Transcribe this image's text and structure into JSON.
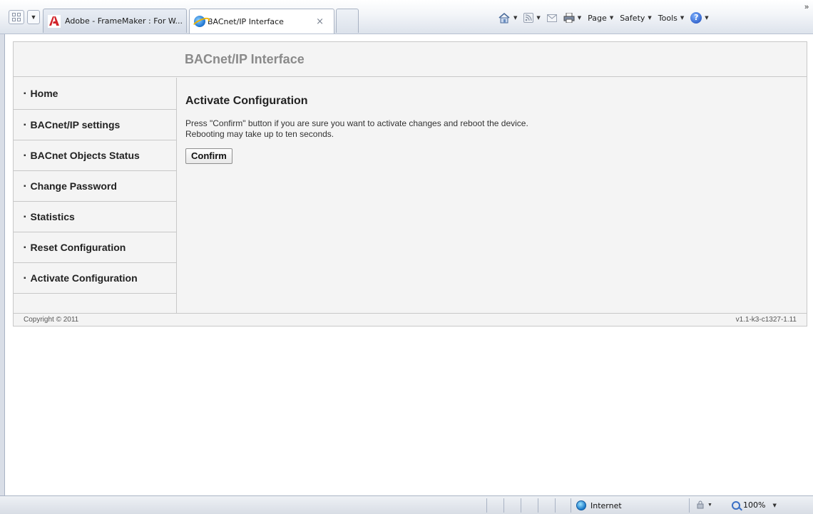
{
  "browser": {
    "tabs": [
      {
        "title": "Adobe - FrameMaker : For W..."
      },
      {
        "title": "BACnet/IP Interface",
        "close": "×"
      }
    ],
    "commands": {
      "page": "Page",
      "safety": "Safety",
      "tools": "Tools",
      "help": "?"
    },
    "status": {
      "zone": "Internet",
      "zoom": "100%"
    }
  },
  "page": {
    "banner_title": "BACnet/IP Interface",
    "nav": [
      {
        "label": "Home"
      },
      {
        "label": "BACnet/IP settings"
      },
      {
        "label": "BACnet Objects Status"
      },
      {
        "label": "Change Password"
      },
      {
        "label": "Statistics"
      },
      {
        "label": "Reset Configuration"
      },
      {
        "label": "Activate Configuration"
      }
    ],
    "main": {
      "title": "Activate Configuration",
      "line1": "Press \"Confirm\" button if you are sure you want to activate changes and reboot the device.",
      "line2": "Rebooting may take up to ten seconds.",
      "confirm_label": "Confirm"
    },
    "footer": {
      "copyright": "Copyright © 2011",
      "version": "v1.1-k3-c1327-1.11"
    }
  },
  "icons": {
    "quick_tabs": "quick-tabs-icon",
    "tab_list": "tab-list-icon",
    "adobe": "adobe-icon",
    "ie": "ie-icon",
    "home": "home-icon",
    "feeds": "feeds-icon",
    "mail": "mail-icon",
    "print": "print-icon",
    "help": "help-icon",
    "globe": "globe-icon",
    "zoom": "zoom-icon"
  }
}
